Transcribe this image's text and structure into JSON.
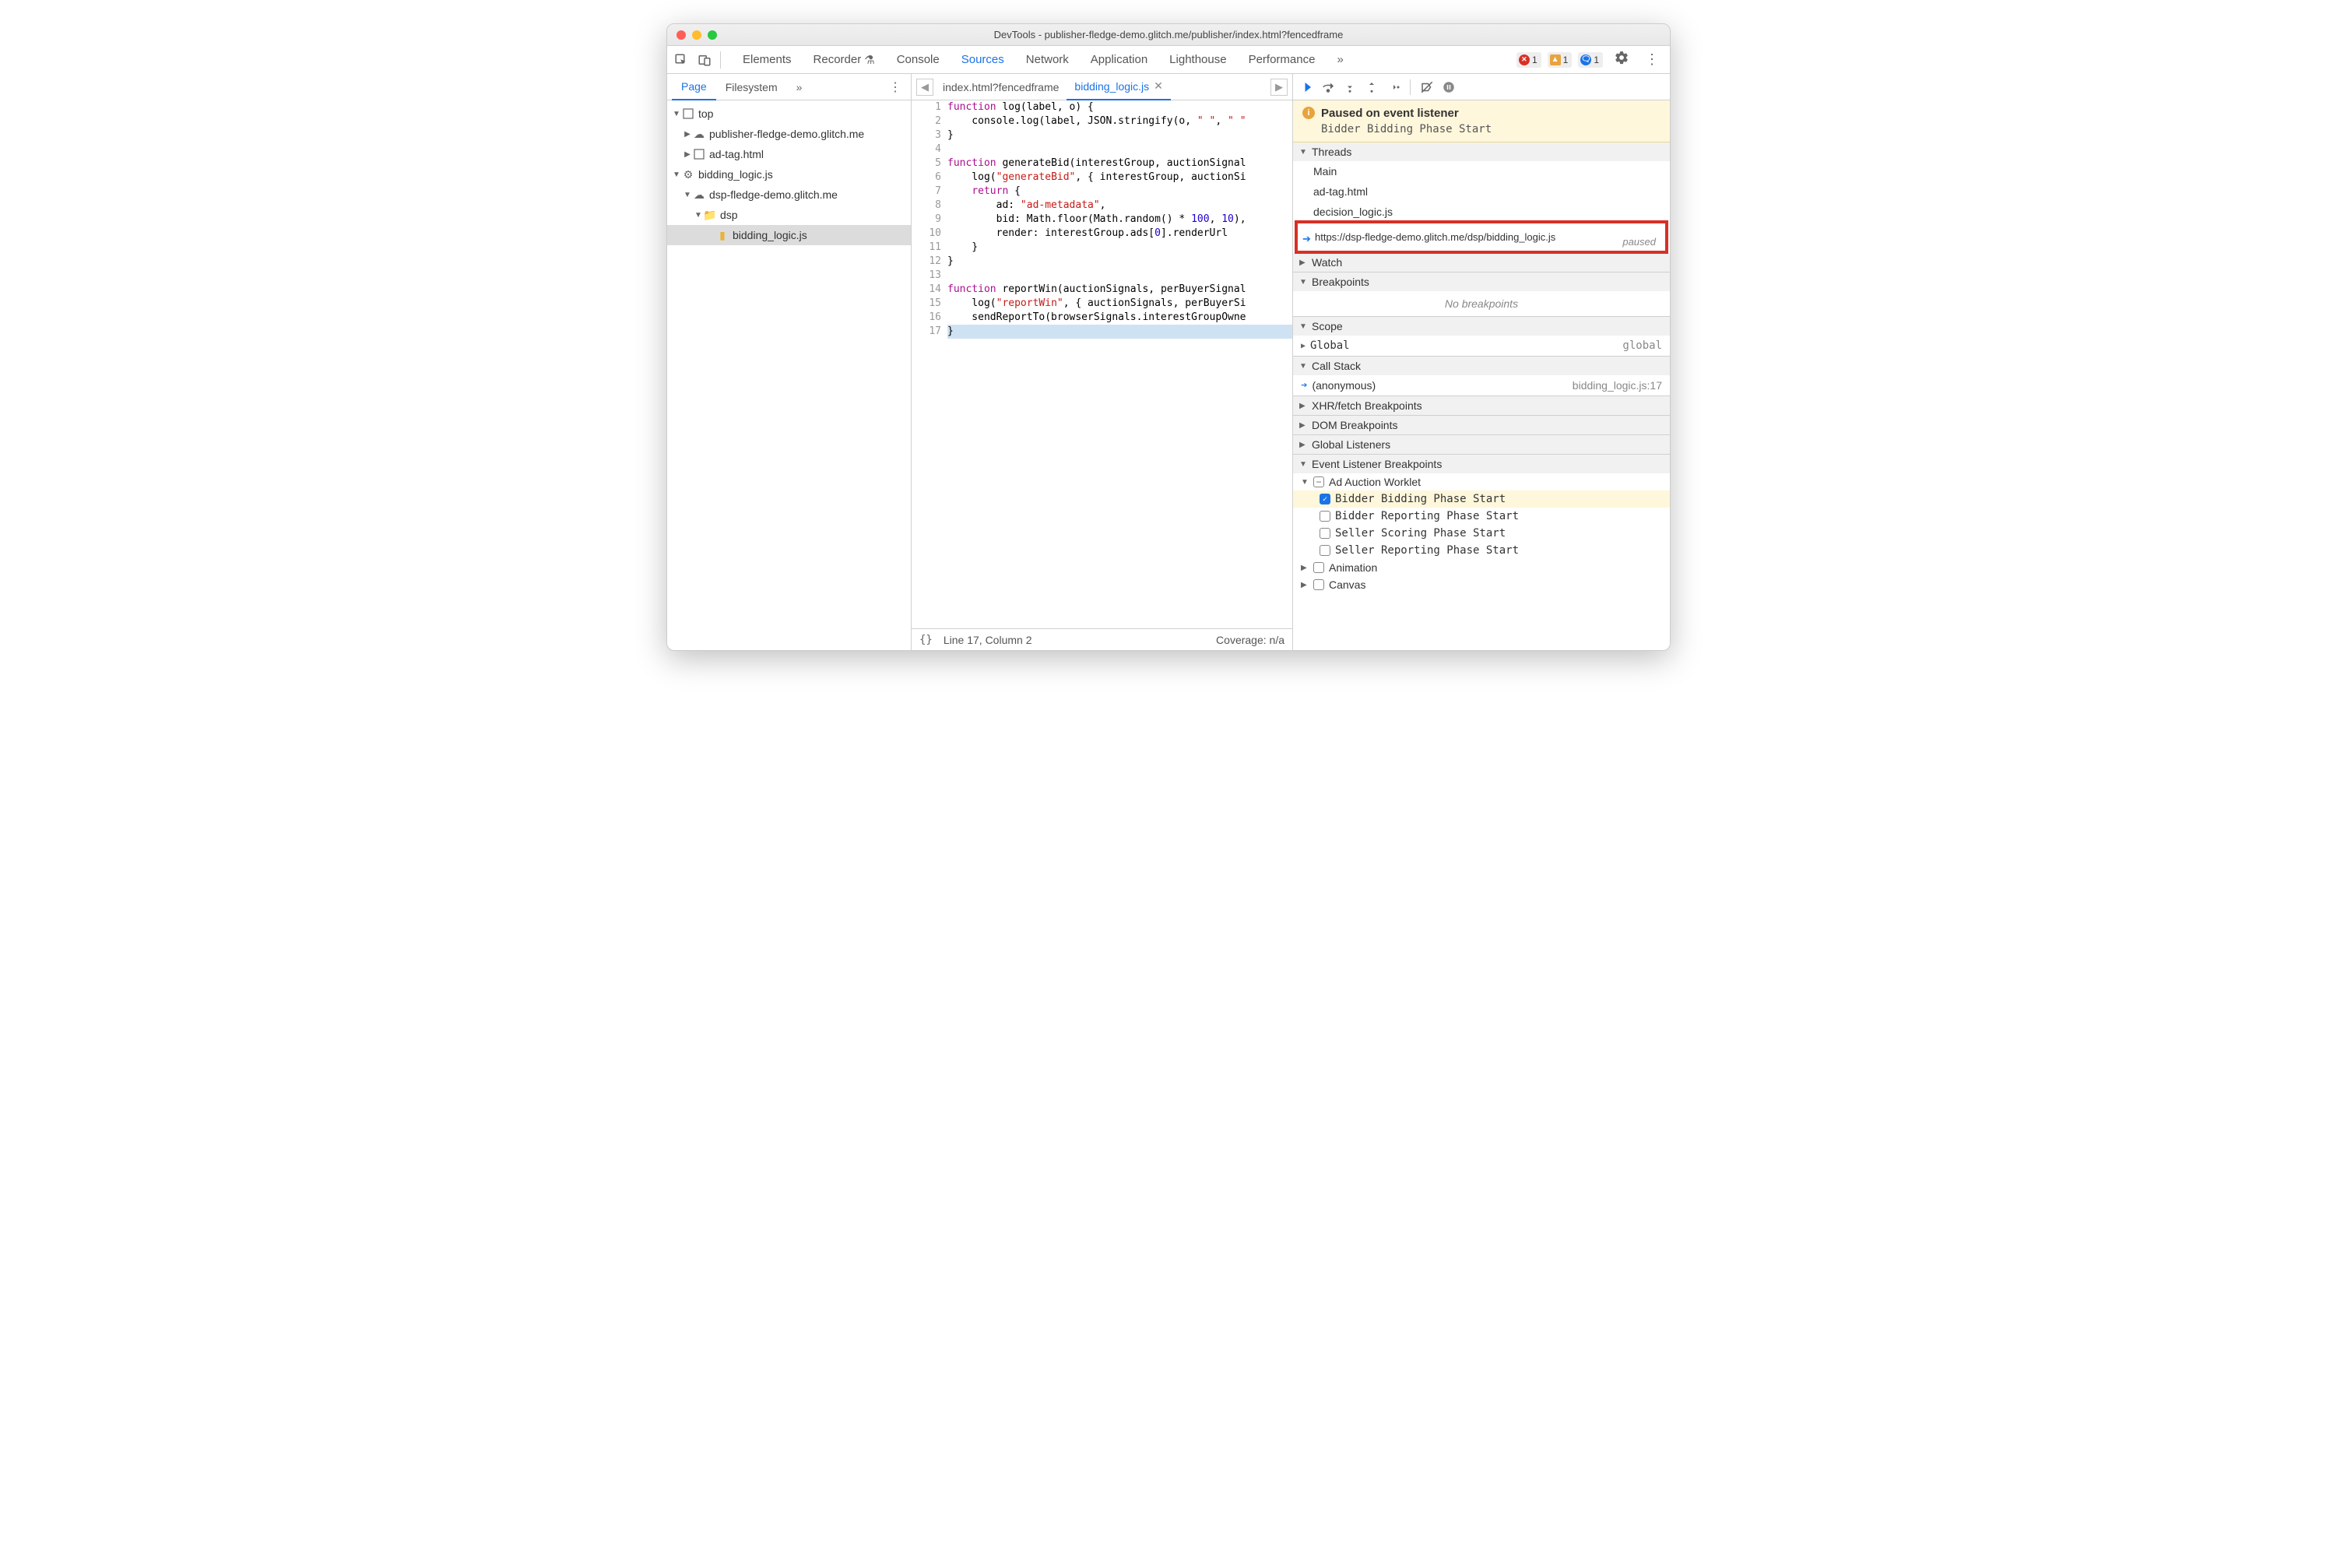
{
  "window": {
    "title": "DevTools - publisher-fledge-demo.glitch.me/publisher/index.html?fencedframe"
  },
  "mainTabs": [
    "Elements",
    "Recorder",
    "Console",
    "Sources",
    "Network",
    "Application",
    "Lighthouse",
    "Performance"
  ],
  "activeMainTab": "Sources",
  "badges": {
    "errors": "1",
    "warnings": "1",
    "info": "1"
  },
  "leftTabs": [
    "Page",
    "Filesystem"
  ],
  "activeLeftTab": "Page",
  "fileTree": {
    "top": "top",
    "pub": "publisher-fledge-demo.glitch.me",
    "adtag": "ad-tag.html",
    "bidding": "bidding_logic.js",
    "dspCloud": "dsp-fledge-demo.glitch.me",
    "dspFolder": "dsp",
    "bidfile": "bidding_logic.js"
  },
  "editorTabs": [
    {
      "label": "index.html?fencedframe",
      "active": false
    },
    {
      "label": "bidding_logic.js",
      "active": true
    }
  ],
  "code": {
    "lines": [
      [
        {
          "t": "kw",
          "v": "function"
        },
        {
          "t": "plain",
          "v": " log(label, o) {"
        }
      ],
      [
        {
          "t": "plain",
          "v": "    console.log(label, JSON.stringify(o, "
        },
        {
          "t": "str",
          "v": "\" \""
        },
        {
          "t": "plain",
          "v": ", "
        },
        {
          "t": "str",
          "v": "\" \""
        }
      ],
      [
        {
          "t": "plain",
          "v": "}"
        }
      ],
      [
        {
          "t": "plain",
          "v": ""
        }
      ],
      [
        {
          "t": "kw",
          "v": "function"
        },
        {
          "t": "plain",
          "v": " generateBid(interestGroup, auctionSignal"
        }
      ],
      [
        {
          "t": "plain",
          "v": "    log("
        },
        {
          "t": "str",
          "v": "\"generateBid\""
        },
        {
          "t": "plain",
          "v": ", { interestGroup, auctionSi"
        }
      ],
      [
        {
          "t": "plain",
          "v": "    "
        },
        {
          "t": "kw",
          "v": "return"
        },
        {
          "t": "plain",
          "v": " {"
        }
      ],
      [
        {
          "t": "plain",
          "v": "        ad: "
        },
        {
          "t": "str",
          "v": "\"ad-metadata\""
        },
        {
          "t": "plain",
          "v": ","
        }
      ],
      [
        {
          "t": "plain",
          "v": "        bid: Math.floor(Math.random() * "
        },
        {
          "t": "num",
          "v": "100"
        },
        {
          "t": "plain",
          "v": ", "
        },
        {
          "t": "num",
          "v": "10"
        },
        {
          "t": "plain",
          "v": "),"
        }
      ],
      [
        {
          "t": "plain",
          "v": "        render: interestGroup.ads["
        },
        {
          "t": "num",
          "v": "0"
        },
        {
          "t": "plain",
          "v": "].renderUrl"
        }
      ],
      [
        {
          "t": "plain",
          "v": "    }"
        }
      ],
      [
        {
          "t": "plain",
          "v": "}"
        }
      ],
      [
        {
          "t": "plain",
          "v": ""
        }
      ],
      [
        {
          "t": "kw",
          "v": "function"
        },
        {
          "t": "plain",
          "v": " reportWin(auctionSignals, perBuyerSignal"
        }
      ],
      [
        {
          "t": "plain",
          "v": "    log("
        },
        {
          "t": "str",
          "v": "\"reportWin\""
        },
        {
          "t": "plain",
          "v": ", { auctionSignals, perBuyerSi"
        }
      ],
      [
        {
          "t": "plain",
          "v": "    sendReportTo(browserSignals.interestGroupOwne"
        }
      ],
      [
        {
          "t": "plain",
          "v": "}"
        }
      ]
    ],
    "highlightLine": 17
  },
  "statusbar": {
    "pos": "Line 17, Column 2",
    "coverage": "Coverage: n/a"
  },
  "pauseBanner": {
    "title": "Paused on event listener",
    "subtitle": "Bidder Bidding Phase Start"
  },
  "threads": {
    "header": "Threads",
    "items": [
      "Main",
      "ad-tag.html",
      "decision_logic.js"
    ],
    "highlighted": "https://dsp-fledge-demo.glitch.me/dsp/bidding_logic.js",
    "pausedLabel": "paused"
  },
  "watch": {
    "header": "Watch"
  },
  "breakpoints": {
    "header": "Breakpoints",
    "empty": "No breakpoints"
  },
  "scope": {
    "header": "Scope",
    "global": "Global",
    "globalVal": "global"
  },
  "callstack": {
    "header": "Call Stack",
    "anon": "(anonymous)",
    "loc": "bidding_logic.js:17"
  },
  "xhr": {
    "header": "XHR/fetch Breakpoints"
  },
  "dom": {
    "header": "DOM Breakpoints"
  },
  "globalListeners": {
    "header": "Global Listeners"
  },
  "elb": {
    "header": "Event Listener Breakpoints",
    "adAuction": "Ad Auction Worklet",
    "items": [
      {
        "label": "Bidder Bidding Phase Start",
        "checked": true
      },
      {
        "label": "Bidder Reporting Phase Start",
        "checked": false
      },
      {
        "label": "Seller Scoring Phase Start",
        "checked": false
      },
      {
        "label": "Seller Reporting Phase Start",
        "checked": false
      }
    ],
    "animation": "Animation",
    "canvas": "Canvas"
  }
}
